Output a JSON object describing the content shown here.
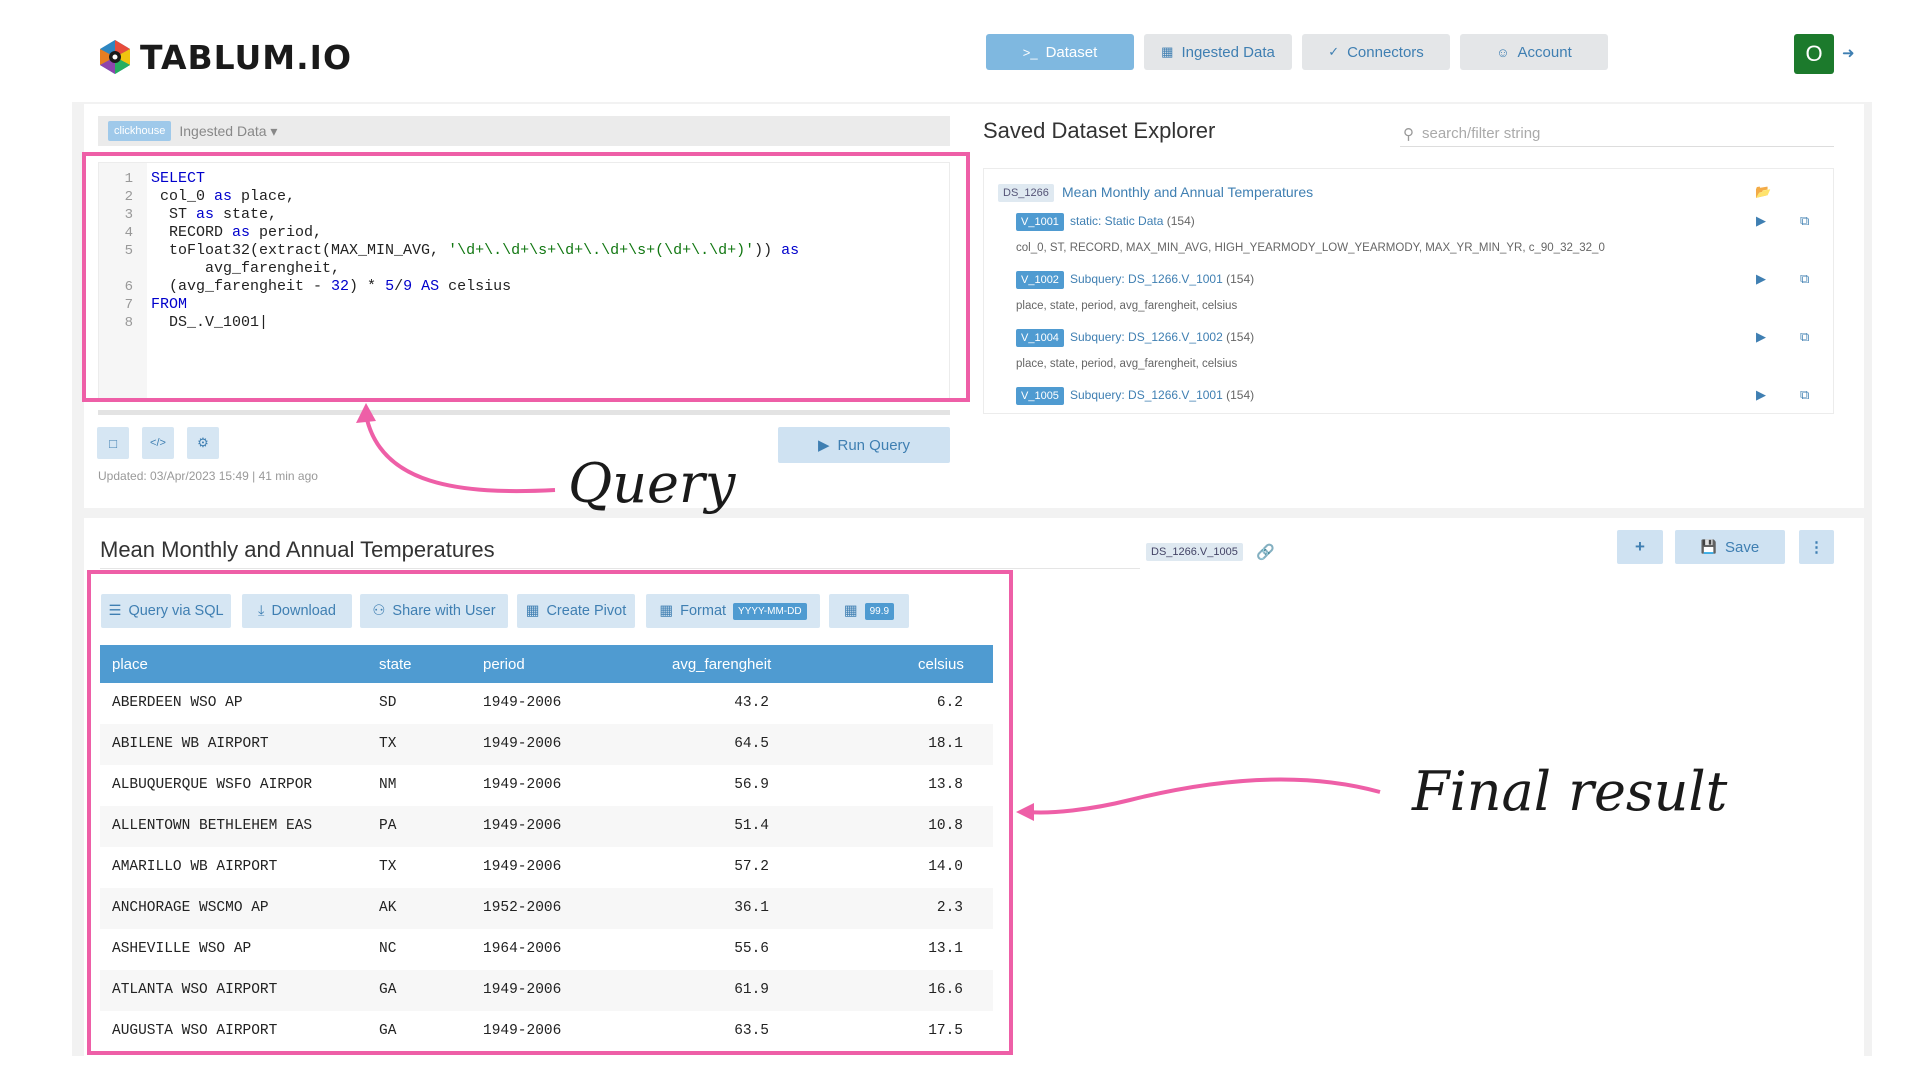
{
  "app": {
    "logo_text": "TABLUM.IO"
  },
  "nav": {
    "dataset": "Dataset",
    "ingested": "Ingested Data",
    "connectors": "Connectors",
    "account": "Account"
  },
  "user": {
    "initial": "O"
  },
  "editor": {
    "engine_badge": "clickhouse",
    "source_label": "Ingested Data",
    "updated": "Updated: 03/Apr/2023 15:49 | 41 min ago",
    "run_label": "Run Query",
    "line_numbers": [
      "1",
      "2",
      "3",
      "4",
      "5",
      "",
      "6",
      "7",
      "8"
    ]
  },
  "explorer": {
    "title": "Saved Dataset Explorer",
    "search_placeholder": "search/filter string",
    "dataset_id": "DS_1266",
    "dataset_name": "Mean Monthly and Annual Temperatures",
    "views": [
      {
        "id": "V_1001",
        "label": "static: Static Data",
        "count": "(154)",
        "columns": "col_0, ST, RECORD, MAX_MIN_AVG, HIGH_YEARMODY_LOW_YEARMODY, MAX_YR_MIN_YR, c_90_32_32_0"
      },
      {
        "id": "V_1002",
        "label": "Subquery: DS_1266.V_1001",
        "count": "(154)",
        "columns": "place, state, period, avg_farengheit, celsius"
      },
      {
        "id": "V_1004",
        "label": "Subquery: DS_1266.V_1002",
        "count": "(154)",
        "columns": "place, state, period, avg_farengheit, celsius"
      },
      {
        "id": "V_1005",
        "label": "Subquery: DS_1266.V_1001",
        "count": "(154)",
        "columns": ""
      }
    ]
  },
  "result": {
    "title": "Mean Monthly and Annual Temperatures",
    "ds_ref": "DS_1266.V_1005",
    "save_label": "Save",
    "actions": {
      "query_sql": "Query via SQL",
      "download": "Download",
      "share": "Share with User",
      "pivot": "Create Pivot",
      "format": "Format",
      "format_badge": "YYYY-MM-DD",
      "precision_badge": "99.9"
    },
    "columns": [
      "place",
      "state",
      "period",
      "avg_farengheit",
      "celsius"
    ],
    "rows": [
      [
        "ABERDEEN WSO AP",
        "SD",
        "1949-2006",
        "43.2",
        "6.2"
      ],
      [
        "ABILENE WB AIRPORT",
        "TX",
        "1949-2006",
        "64.5",
        "18.1"
      ],
      [
        "ALBUQUERQUE WSFO AIRPOR",
        "NM",
        "1949-2006",
        "56.9",
        "13.8"
      ],
      [
        "ALLENTOWN BETHLEHEM EAS",
        "PA",
        "1949-2006",
        "51.4",
        "10.8"
      ],
      [
        "AMARILLO WB AIRPORT",
        "TX",
        "1949-2006",
        "57.2",
        "14.0"
      ],
      [
        "ANCHORAGE WSCMO AP",
        "AK",
        "1952-2006",
        "36.1",
        "2.3"
      ],
      [
        "ASHEVILLE WSO AP",
        "NC",
        "1964-2006",
        "55.6",
        "13.1"
      ],
      [
        "ATLANTA WSO AIRPORT",
        "GA",
        "1949-2006",
        "61.9",
        "16.6"
      ],
      [
        "AUGUSTA WSO AIRPORT",
        "GA",
        "1949-2006",
        "63.5",
        "17.5"
      ]
    ]
  },
  "annotations": {
    "query": "Query",
    "final": "Final result"
  },
  "colors": {
    "highlight": "#ee5fa7",
    "accent": "#4f9bd1",
    "brand_green": "#1c7a2c"
  }
}
